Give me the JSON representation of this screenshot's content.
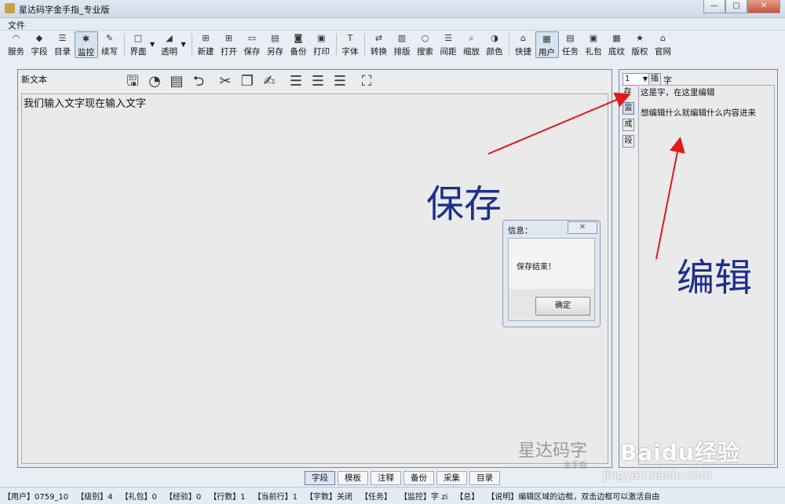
{
  "window": {
    "title": "星达码字金手指_专业版",
    "buttons": [
      "—",
      "▢",
      "✕"
    ]
  },
  "menu": {
    "items": [
      "文件"
    ]
  },
  "toolbar": {
    "items": [
      {
        "label": "服务",
        "icon": "rss-icon",
        "glyph": "◠"
      },
      {
        "label": "字段",
        "icon": "diamond-icon",
        "glyph": "◆"
      },
      {
        "label": "目录",
        "icon": "list-icon",
        "glyph": "☰"
      },
      {
        "label": "监控",
        "icon": "bug-icon",
        "glyph": "✱",
        "active": true
      },
      {
        "label": "续写",
        "icon": "pen-icon",
        "glyph": "✎"
      },
      {
        "label": "界面",
        "icon": "window-icon",
        "glyph": "□"
      },
      {
        "label": "透明",
        "icon": "transparency-icon",
        "glyph": "◢"
      },
      {
        "label": "新建",
        "icon": "new-icon",
        "glyph": "⊞"
      },
      {
        "label": "打开",
        "icon": "open-icon",
        "glyph": "⊞"
      },
      {
        "label": "保存",
        "icon": "save-icon",
        "glyph": "▭"
      },
      {
        "label": "另存",
        "icon": "save-as-icon",
        "glyph": "▤"
      },
      {
        "label": "备份",
        "icon": "backup-icon",
        "glyph": "◙"
      },
      {
        "label": "打印",
        "icon": "print-icon",
        "glyph": "▣"
      },
      {
        "label": "字体",
        "icon": "font-icon",
        "glyph": "T"
      },
      {
        "label": "转换",
        "icon": "convert-icon",
        "glyph": "⇄"
      },
      {
        "label": "排版",
        "icon": "layout-icon",
        "glyph": "▥"
      },
      {
        "label": "搜索",
        "icon": "search-icon",
        "glyph": "○"
      },
      {
        "label": "间距",
        "icon": "spacing-icon",
        "glyph": "☰"
      },
      {
        "label": "缩放",
        "icon": "zoom-icon",
        "glyph": "⌕"
      },
      {
        "label": "颜色",
        "icon": "color-icon",
        "glyph": "◑"
      },
      {
        "label": "快捷",
        "icon": "shortcut-icon",
        "glyph": "⌂"
      },
      {
        "label": "用户",
        "icon": "user-icon",
        "glyph": "▦",
        "active": true
      },
      {
        "label": "任务",
        "icon": "task-icon",
        "glyph": "▤"
      },
      {
        "label": "礼包",
        "icon": "gift-icon",
        "glyph": "▣"
      },
      {
        "label": "底纹",
        "icon": "texture-icon",
        "glyph": "▦"
      },
      {
        "label": "版权",
        "icon": "copyright-icon",
        "glyph": "★"
      },
      {
        "label": "官网",
        "icon": "website-icon",
        "glyph": "⌂"
      }
    ]
  },
  "editor": {
    "doc_name": "新文本",
    "content": "我们输入文字现在输入文字",
    "logo_main": "星达码字",
    "logo_sub": "金手指"
  },
  "side": {
    "select_value": "1",
    "insert_label": "插",
    "char_label": "字",
    "tabs": [
      "存",
      "监",
      "成",
      "段"
    ],
    "line1": "这是字，在这里编辑",
    "line2": "想编辑什么就编辑什么内容进来"
  },
  "annotations": {
    "save": "保存",
    "edit": "编辑"
  },
  "dialog": {
    "title": "信息：",
    "message": "保存结束！",
    "ok": "确定"
  },
  "bottom_tabs": [
    "字段",
    "模板",
    "注释",
    "备份",
    "采集",
    "目录"
  ],
  "status": [
    "【用户】0759_10",
    "【级别】4",
    "【礼包】0",
    "【经验】0",
    "【行数】1",
    "【当前行】1",
    "【字数】关闭",
    "【任务】",
    "【监控】字 zi",
    "【总】",
    "【说明】编辑区域的边框，双击边框可以激活自由"
  ],
  "watermark": {
    "brand": "Baidu经验",
    "url": "jingyan.baidu.com"
  },
  "colors": {
    "annotation": "#1c2f8e",
    "arrow": "#e0191b"
  }
}
